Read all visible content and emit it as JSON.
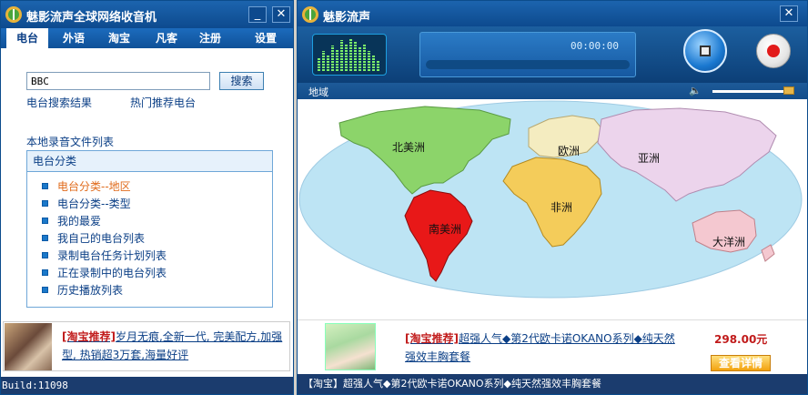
{
  "left_window": {
    "title": "魅影流声全球网络收音机",
    "minimize_label": "_",
    "close_label": "✕",
    "nav_tabs": [
      "电台",
      "外语",
      "淘宝",
      "凡客",
      "注册",
      "设置"
    ],
    "search": {
      "value": "BBC",
      "button_label": "搜索"
    },
    "links": {
      "search_results": "电台搜索结果",
      "hot_stations": "热门推荐电台",
      "local_recordings": "本地录音文件列表"
    },
    "category": {
      "header": "电台分类",
      "items": [
        "电台分类--地区",
        "电台分类--类型",
        "我的最爱",
        "我自己的电台列表",
        "录制电台任务计划列表",
        "正在录制中的电台列表",
        "历史播放列表"
      ]
    },
    "ad": {
      "tag": "[淘宝推荐]",
      "text": "岁月无痕,全新一代, 完美配方,加强型, 热销超3万套,海量好评"
    },
    "status": "Build:11098"
  },
  "right_window": {
    "title": "魅影流声",
    "close_label": "✕",
    "time": "00:00:00",
    "region_label": "地域",
    "continents": [
      "北美洲",
      "欧洲",
      "亚洲",
      "非洲",
      "南美洲",
      "大洋洲"
    ],
    "ad": {
      "tag": "[淘宝推荐]",
      "text": "超强人气◆第2代欧卡诺OKANO系列◆纯天然强效丰胸套餐",
      "price": "298.00元",
      "button_label": "查看详情"
    },
    "status": "【淘宝】超强人气◆第2代欧卡诺OKANO系列◆纯天然强效丰胸套餐"
  },
  "colors": {
    "title_bg": "#0d4a8e",
    "highlight_continent": "#e81818",
    "north_america": "#8cd46a",
    "europe": "#f4ecc0",
    "asia": "#ecd4ec",
    "africa": "#f4cc5a",
    "oceania": "#f4c8d0",
    "ocean": "#bde4f4"
  }
}
